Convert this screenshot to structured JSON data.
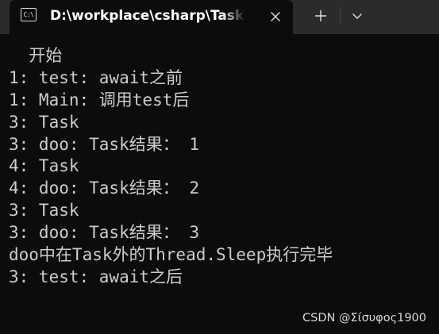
{
  "tab": {
    "icon": "console-icon",
    "icon_glyph": "C:\\",
    "title": "D:\\workplace\\csharp\\TaskTest"
  },
  "controls": {
    "close_icon": "close-icon",
    "new_tab_icon": "plus-icon",
    "dropdown_icon": "chevron-down-icon"
  },
  "console": {
    "lines": [
      "  开始",
      "1: test: await之前",
      "1: Main: 调用test后",
      "3: Task",
      "3: doo: Task结果： 1",
      "4: Task",
      "4: doo: Task结果： 2",
      "3: Task",
      "3: doo: Task结果： 3",
      "doo中在Task外的Thread.Sleep执行完毕",
      "3: test: await之后"
    ]
  },
  "watermark": "CSDN @Σίσυφος1900",
  "colors": {
    "background": "#0c0c0c",
    "tabbar": "#2b2b2b",
    "text": "#cccccc"
  }
}
